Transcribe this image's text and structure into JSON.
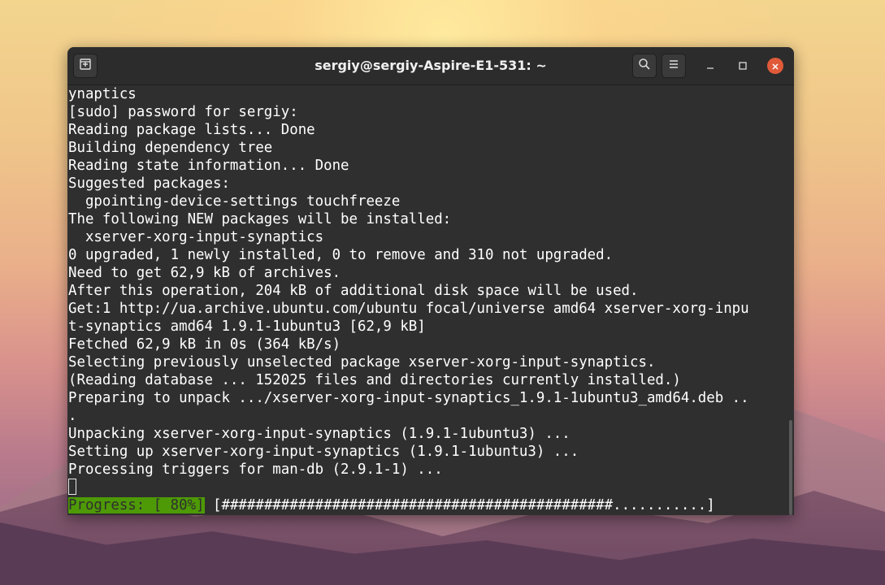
{
  "window": {
    "title": "sergiy@sergiy-Aspire-E1-531: ~"
  },
  "icons": {
    "new_tab": "new-tab-icon",
    "search": "search-icon",
    "menu": "hamburger-menu-icon",
    "minimize": "minimize-icon",
    "maximize": "maximize-icon",
    "close": "close-icon"
  },
  "colors": {
    "terminal_bg": "#2f2f2f",
    "terminal_fg": "#ffffff",
    "progress_bg": "#4e9a06",
    "close_button": "#e05a3a"
  },
  "terminal": {
    "lines": [
      "ynaptics",
      "[sudo] password for sergiy:",
      "Reading package lists... Done",
      "Building dependency tree",
      "Reading state information... Done",
      "Suggested packages:",
      "  gpointing-device-settings touchfreeze",
      "The following NEW packages will be installed:",
      "  xserver-xorg-input-synaptics",
      "0 upgraded, 1 newly installed, 0 to remove and 310 not upgraded.",
      "Need to get 62,9 kB of archives.",
      "After this operation, 204 kB of additional disk space will be used.",
      "Get:1 http://ua.archive.ubuntu.com/ubuntu focal/universe amd64 xserver-xorg-inpu",
      "t-synaptics amd64 1.9.1-1ubuntu3 [62,9 kB]",
      "Fetched 62,9 kB in 0s (364 kB/s)",
      "Selecting previously unselected package xserver-xorg-input-synaptics.",
      "(Reading database ... 152025 files and directories currently installed.)",
      "Preparing to unpack .../xserver-xorg-input-synaptics_1.9.1-1ubuntu3_amd64.deb ..",
      ".",
      "Unpacking xserver-xorg-input-synaptics (1.9.1-1ubuntu3) ...",
      "Setting up xserver-xorg-input-synaptics (1.9.1-1ubuntu3) ...",
      "Processing triggers for man-db (2.9.1-1) ..."
    ],
    "progress_label": "Progress: [ 80%]",
    "progress_bar": " [##############################################...........]",
    "progress_percent": 80
  }
}
